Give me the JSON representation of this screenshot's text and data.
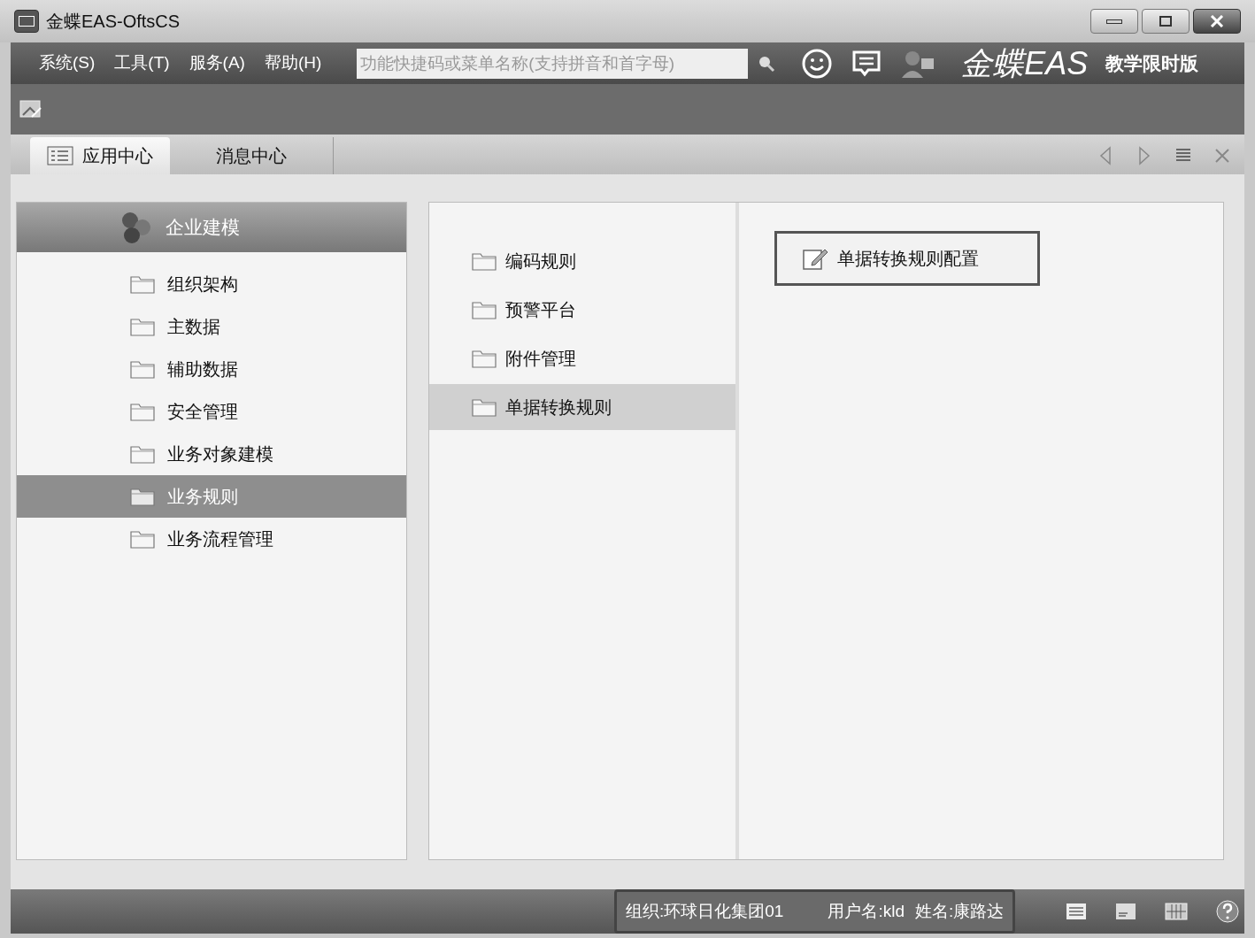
{
  "window": {
    "title": "金蝶EAS-OftsCS"
  },
  "menu": [
    "系统(S)",
    "工具(T)",
    "服务(A)",
    "帮助(H)"
  ],
  "search": {
    "placeholder": "功能快捷码或菜单名称(支持拼音和首字母)"
  },
  "brand": {
    "logo": "金蝶EAS",
    "edition": "教学限时版"
  },
  "tabs": [
    {
      "label": "应用中心",
      "selected": true
    },
    {
      "label": "消息中心",
      "selected": false
    }
  ],
  "category": {
    "title": "企业建模"
  },
  "modules": [
    {
      "label": "组织架构",
      "selected": false
    },
    {
      "label": "主数据",
      "selected": false
    },
    {
      "label": "辅助数据",
      "selected": false
    },
    {
      "label": "安全管理",
      "selected": false
    },
    {
      "label": "业务对象建模",
      "selected": false
    },
    {
      "label": "业务规则",
      "selected": true
    },
    {
      "label": "业务流程管理",
      "selected": false
    }
  ],
  "folders": [
    {
      "label": "编码规则",
      "selected": false
    },
    {
      "label": "预警平台",
      "selected": false
    },
    {
      "label": "附件管理",
      "selected": false
    },
    {
      "label": "单据转换规则",
      "selected": true
    }
  ],
  "functions": [
    {
      "label": "单据转换规则配置"
    }
  ],
  "status_bar": {
    "org": "组织:环球日化集团01",
    "user": "用户名:kld",
    "name": "姓名:康路达"
  }
}
